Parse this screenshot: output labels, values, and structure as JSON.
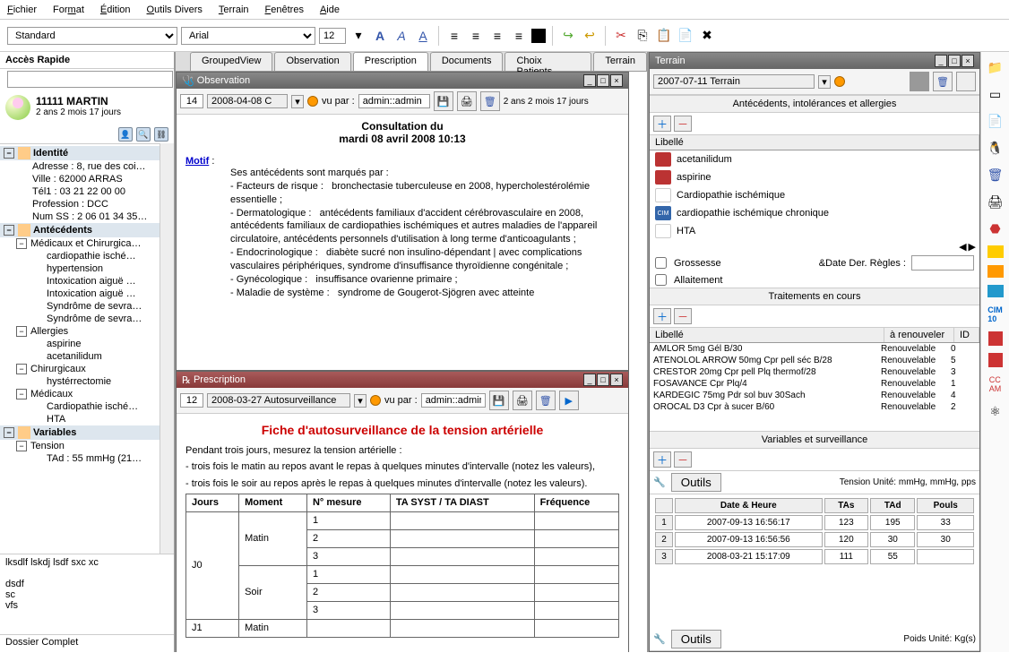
{
  "menubar": [
    "Fichier",
    "Format",
    "Édition",
    "Outils Divers",
    "Terrain",
    "Fenêtres",
    "Aide"
  ],
  "toolbar": {
    "style": "Standard",
    "font": "Arial",
    "size": "12"
  },
  "quickaccess": {
    "title": "Accès Rapide"
  },
  "patient": {
    "name": "11111 MARTIN",
    "sub": "2 ans 2 mois 17 jours"
  },
  "tree": {
    "identite": {
      "label": "Identité",
      "rows": [
        "Adresse : 8, rue des coi…",
        "Ville : 62000 ARRAS",
        "Tél1 : 03 21 22 00 00",
        "Profession : DCC",
        "Num SS : 2 06 01 34 35…"
      ]
    },
    "antecedents": {
      "label": "Antécédents",
      "mc": "Médicaux et Chirurgica…",
      "mc_items": [
        "cardiopathie isché…",
        "hypertension",
        "Intoxication aiguë …",
        "Intoxication aiguë …",
        "Syndrôme de sevra…",
        "Syndrôme de sevra…"
      ],
      "allergies": "Allergies",
      "allergies_items": [
        "aspirine",
        "acetanilidum"
      ],
      "chir": "Chirurgicaux",
      "chir_items": [
        "hystérrectomie"
      ],
      "med": "Médicaux",
      "med_items": [
        "Cardiopathie isché…",
        "HTA"
      ]
    },
    "variables": {
      "label": "Variables",
      "tension": "Tension",
      "tension_items": [
        "TAd : 55 mmHg (21…"
      ]
    }
  },
  "notes": [
    "lksdlf lskdj lsdf sxc xc",
    "",
    "dsdf",
    "sc",
    "vfs"
  ],
  "status": "Dossier Complet",
  "tabs": [
    "GroupedView",
    "Observation",
    "Prescription",
    "Documents",
    "Choix Patients",
    "Terrain"
  ],
  "obs": {
    "title": "Observation",
    "num": "14",
    "date": "2008-04-08 C",
    "vupar": "vu par :",
    "user": "admin::admin",
    "age": "2 ans 2 mois 17 jours",
    "h1": "Consultation du",
    "h2": "mardi 08 avril 2008 10:13",
    "motif": "Motif",
    "body": "Ses antécédents sont marqués par :\n- Facteurs de risque :   bronchectasie tuberculeuse en 2008, hypercholestérolémie essentielle ;\n- Dermatologique :   antécédents familiaux d'accident cérébrovasculaire en 2008, antécédents familiaux de cardiopathies ischémiques et autres maladies de l'appareil circulatoire, antécédents personnels d'utilisation à long terme d'anticoagulants ;\n- Endocrinologique :   diabète sucré non insulino-dépendant | avec complications vasculaires périphériques, syndrome d'insuffisance thyroïdienne congénitale ;\n- Gynécologique :   insuffisance ovarienne primaire ;\n- Maladie de système :   syndrome de Gougerot-Sjögren avec atteinte"
  },
  "presc": {
    "title": "Prescription",
    "num": "12",
    "date": "2008-03-27 Autosurveillance",
    "vupar": "vu par :",
    "user": "admin::admin",
    "heading": "Fiche d'autosurveillance de la tension artérielle",
    "text1": "Pendant trois jours, mesurez la tension artérielle :",
    "text2": "- trois fois le matin au repos avant le repas à quelques minutes d'intervalle (notez les valeurs),",
    "text3": "- trois fois le soir au repos après le repas à quelques minutes d'intervalle (notez les valeurs).",
    "cols": [
      "Jours",
      "Moment",
      "N° mesure",
      "TA SYST / TA DIAST",
      "Fréquence"
    ],
    "rows": [
      [
        "J0",
        "Matin",
        "1",
        "",
        ""
      ],
      [
        "",
        "",
        "2",
        "",
        ""
      ],
      [
        "",
        "",
        "3",
        "",
        ""
      ],
      [
        "",
        "Soir",
        "1",
        "",
        ""
      ],
      [
        "",
        "",
        "2",
        "",
        ""
      ],
      [
        "",
        "",
        "3",
        "",
        ""
      ],
      [
        "J1",
        "Matin",
        "",
        "",
        ""
      ]
    ]
  },
  "terrain": {
    "title": "Terrain",
    "date": "2007-07-11 Terrain",
    "sec1": "Antécédents, intolérances et allergies",
    "libelle": "Libellé",
    "ante": [
      {
        "tag": "crat",
        "label": "acetanilidum"
      },
      {
        "tag": "crat",
        "label": "aspirine"
      },
      {
        "tag": "blank",
        "label": "Cardiopathie ischémique"
      },
      {
        "tag": "cim",
        "label": "cardiopathie ischémique chronique"
      },
      {
        "tag": "blank",
        "label": "HTA"
      }
    ],
    "grossesse": "Grossesse",
    "dateregles": "&Date Der. Règles :",
    "allait": "Allaitement",
    "sec2": "Traitements en cours",
    "cols2": [
      "Libellé",
      "à renouveler",
      "ID"
    ],
    "treat": [
      [
        "AMLOR 5mg Gél B/30",
        "Renouvelable",
        "0"
      ],
      [
        "ATENOLOL ARROW 50mg Cpr pell séc B/28",
        "Renouvelable",
        "5"
      ],
      [
        "CRESTOR 20mg Cpr pell Plq thermof/28",
        "Renouvelable",
        "3"
      ],
      [
        "FOSAVANCE Cpr Plq/4",
        "Renouvelable",
        "1"
      ],
      [
        "KARDEGIC 75mg Pdr sol buv 30Sach",
        "Renouvelable",
        "4"
      ],
      [
        "OROCAL D3 Cpr à sucer B/60",
        "Renouvelable",
        "2"
      ]
    ],
    "sec3": "Variables et surveillance",
    "outils": "Outils",
    "tension_unit": "Tension  Unité: mmHg,  mmHg,  pps",
    "tcols": [
      "",
      "Date & Heure",
      "TAs",
      "TAd",
      "Pouls"
    ],
    "trows": [
      [
        "1",
        "2007-09-13  16:56:17",
        "123",
        "195",
        "33"
      ],
      [
        "2",
        "2007-09-13  16:56:56",
        "120",
        "30",
        "30"
      ],
      [
        "3",
        "2008-03-21  15:17:09",
        "111",
        "55",
        ""
      ]
    ],
    "poids_unit": "Poids  Unité: Kg(s)"
  }
}
